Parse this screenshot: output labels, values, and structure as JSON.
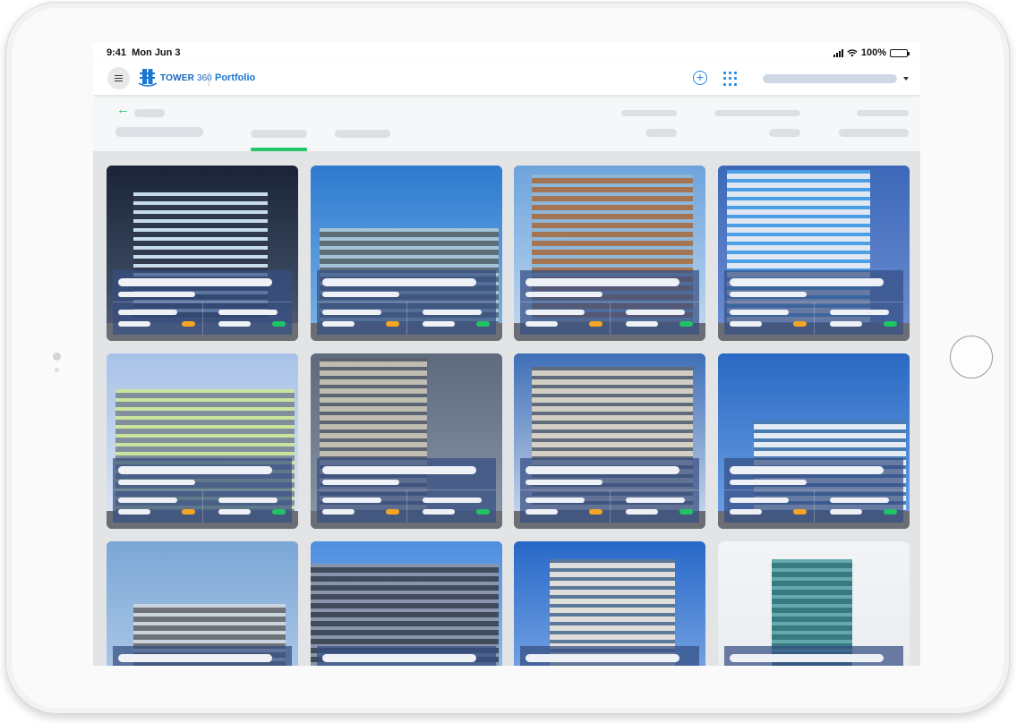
{
  "status_bar": {
    "time": "9:41",
    "date": "Mon Jun 3",
    "battery": "100%"
  },
  "nav": {
    "logo_word": "TOWER",
    "logo_number": "360",
    "section_title": "Portfolio",
    "add_glyph": "+"
  },
  "subheader": {
    "back_glyph": "←"
  },
  "colors": {
    "brand_blue": "#1976d2",
    "accent_green": "#24c76c",
    "status_orange": "#f5a524",
    "status_green": "#20c464",
    "card_overlay": "#344e82"
  },
  "icons": [
    "menu-icon",
    "tower360-logo-icon",
    "add-circle-icon",
    "apps-grid-icon",
    "chevron-down-icon",
    "back-arrow-icon",
    "signal-icon",
    "wifi-icon",
    "battery-icon"
  ],
  "properties": [
    {
      "status_left": "orange",
      "status_right": "green",
      "scene": "night-glass"
    },
    {
      "status_left": "orange",
      "status_right": "green",
      "scene": "office-trees"
    },
    {
      "status_left": "orange",
      "status_right": "green",
      "scene": "brick-glass"
    },
    {
      "status_left": "orange",
      "status_right": "green",
      "scene": "blue-dusk"
    },
    {
      "status_left": "orange",
      "status_right": "green",
      "scene": "glass-atrium"
    },
    {
      "status_left": "orange",
      "status_right": "green",
      "scene": "grey-tower"
    },
    {
      "status_left": "orange",
      "status_right": "green",
      "scene": "classic-stone"
    },
    {
      "status_left": "orange",
      "status_right": "green",
      "scene": "white-panel"
    },
    {
      "status_left": "orange",
      "status_right": "green",
      "scene": "mall-flags"
    },
    {
      "status_left": "orange",
      "status_right": "green",
      "scene": "twin-towers"
    },
    {
      "status_left": "orange",
      "status_right": "green",
      "scene": "modern-hotel"
    },
    {
      "status_left": "orange",
      "status_right": "green",
      "scene": "teal-cube"
    }
  ]
}
